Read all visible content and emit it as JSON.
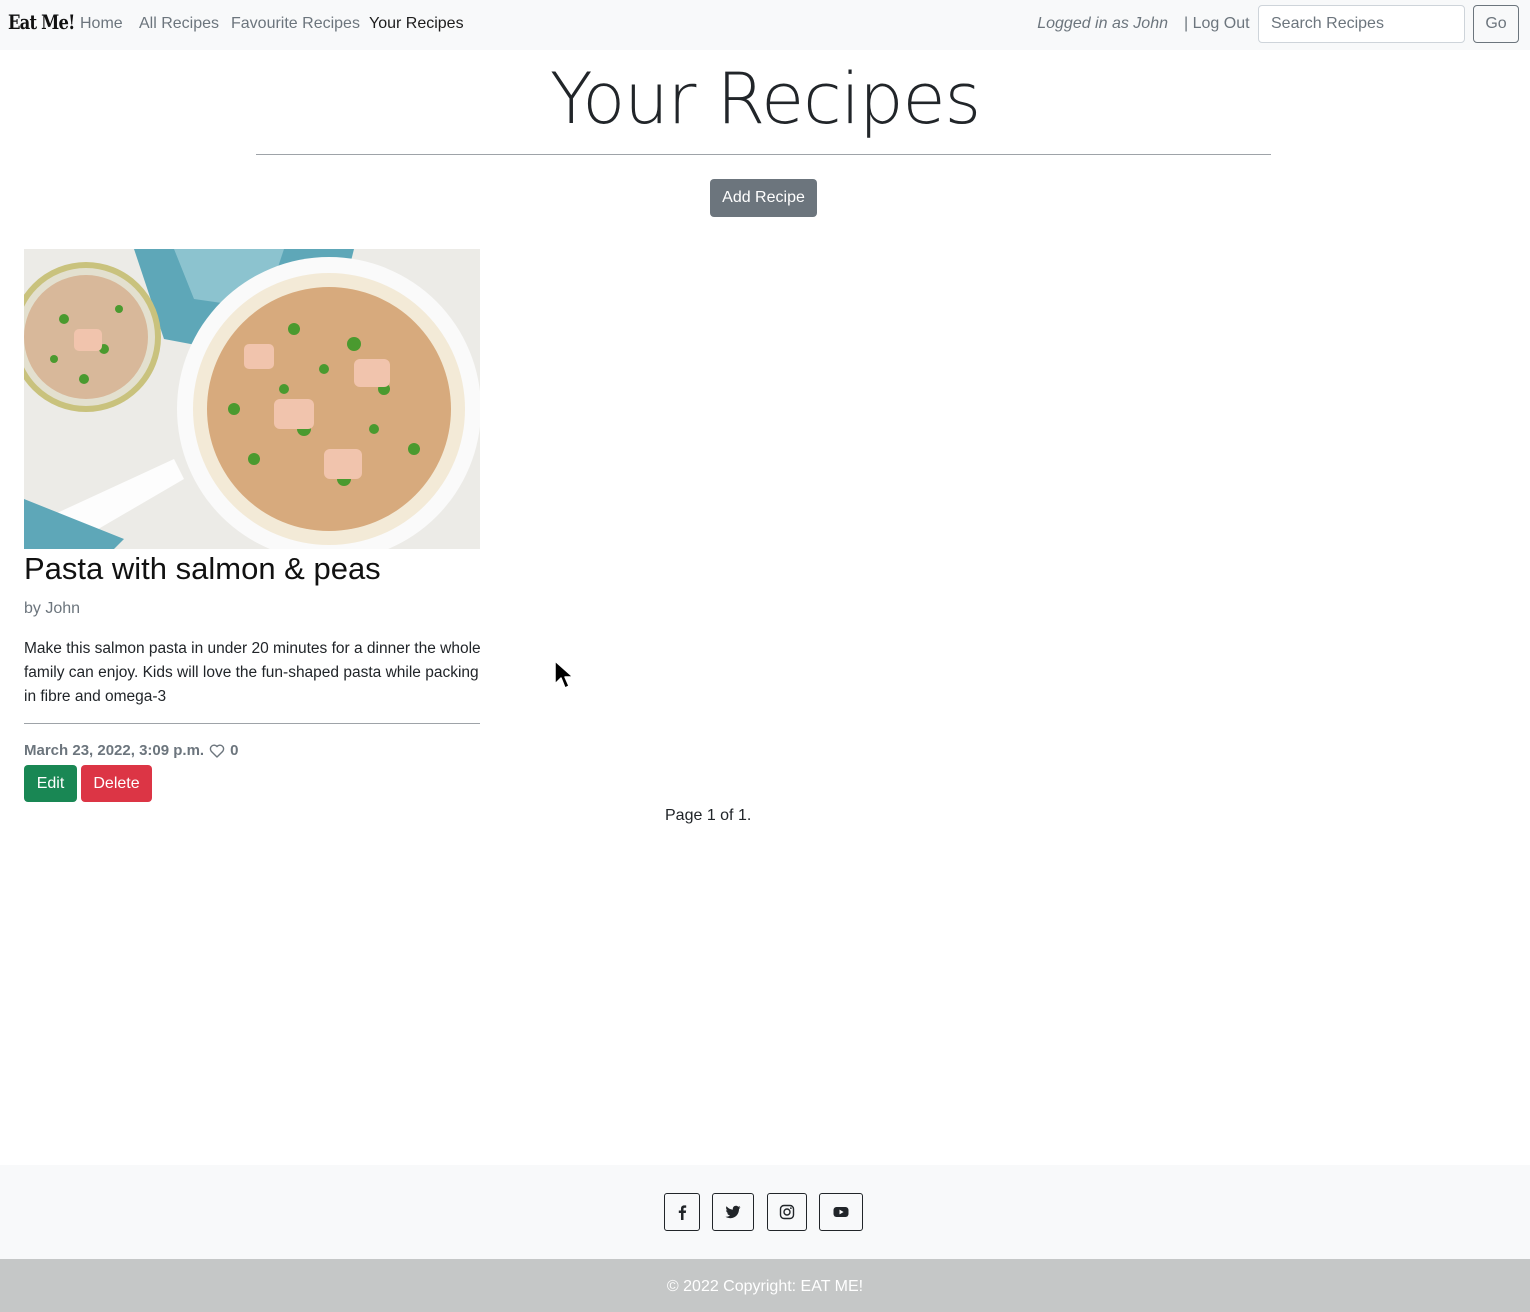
{
  "navbar": {
    "brand": "Eat Me!",
    "links": [
      {
        "label": "Home"
      },
      {
        "label": "All Recipes"
      },
      {
        "label": "Favourite Recipes"
      },
      {
        "label": "Your Recipes",
        "active": true
      }
    ],
    "logged_in_text": "Logged in as John",
    "logout_label": "| Log Out",
    "search_placeholder": "Search Recipes",
    "search_button_label": "Go"
  },
  "header": {
    "title": "Your Recipes",
    "add_button_label": "Add Recipe"
  },
  "recipes": [
    {
      "title": "Pasta with salmon & peas",
      "author": "by John",
      "description": "Make this salmon pasta in under 20 minutes for a dinner the whole family can enjoy. Kids will love the fun-shaped pasta while packing in fibre and omega-3",
      "date": "March 23, 2022, 3:09 p.m.",
      "likes": "0",
      "edit_label": "Edit",
      "delete_label": "Delete"
    }
  ],
  "pagination": {
    "text": "Page 1 of 1."
  },
  "footer": {
    "social_icons": [
      "facebook-icon",
      "twitter-icon",
      "instagram-icon",
      "youtube-icon"
    ],
    "copyright": "© 2022 Copyright: EAT ME!"
  },
  "colors": {
    "navbar_bg": "#f8f9fa",
    "secondary": "#6c757d",
    "success": "#198754",
    "danger": "#dc3545",
    "footer_bottom_bg": "#c5c7c7"
  }
}
